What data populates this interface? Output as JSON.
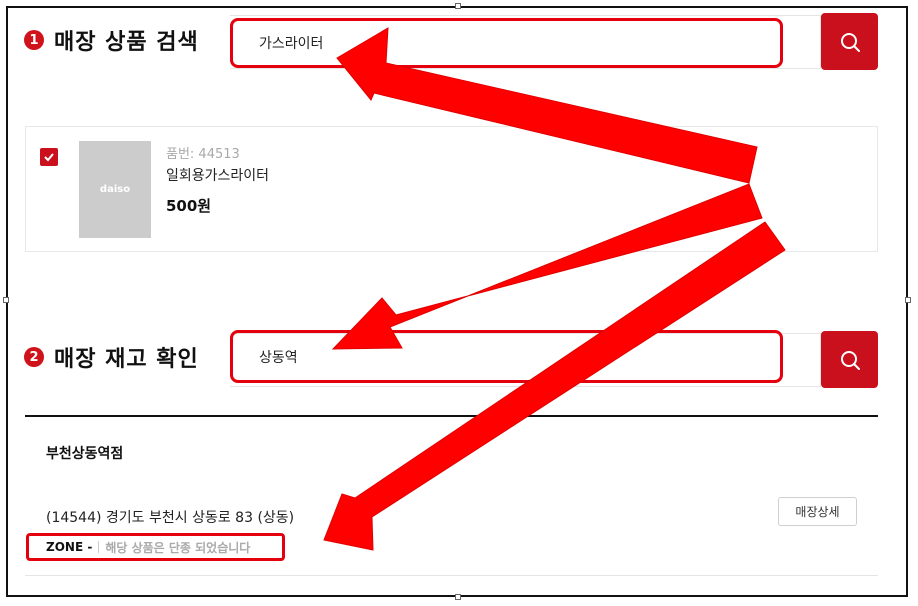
{
  "section1": {
    "number": "1",
    "title": "매장 상품 검색",
    "search_value": "가스라이터"
  },
  "product": {
    "code": "품번: 44513",
    "name": "일회용가스라이터",
    "price": "500원",
    "thumb_text": "daiso",
    "checked": true
  },
  "section2": {
    "number": "2",
    "title": "매장 재고 확인",
    "search_value": "상동역"
  },
  "store": {
    "name": "부천상동역점",
    "address": "(14544) 경기도 부천시 상동로 83 (상동)",
    "detail_button": "매장상세",
    "zone_label": "ZONE -",
    "zone_message": "해당 상품은 단종 되었습니다"
  },
  "colors": {
    "accent": "#c9101c",
    "highlight": "#e5000d",
    "arrow": "#ff0000"
  },
  "icons": {
    "search": "search-icon",
    "check": "check-icon"
  }
}
